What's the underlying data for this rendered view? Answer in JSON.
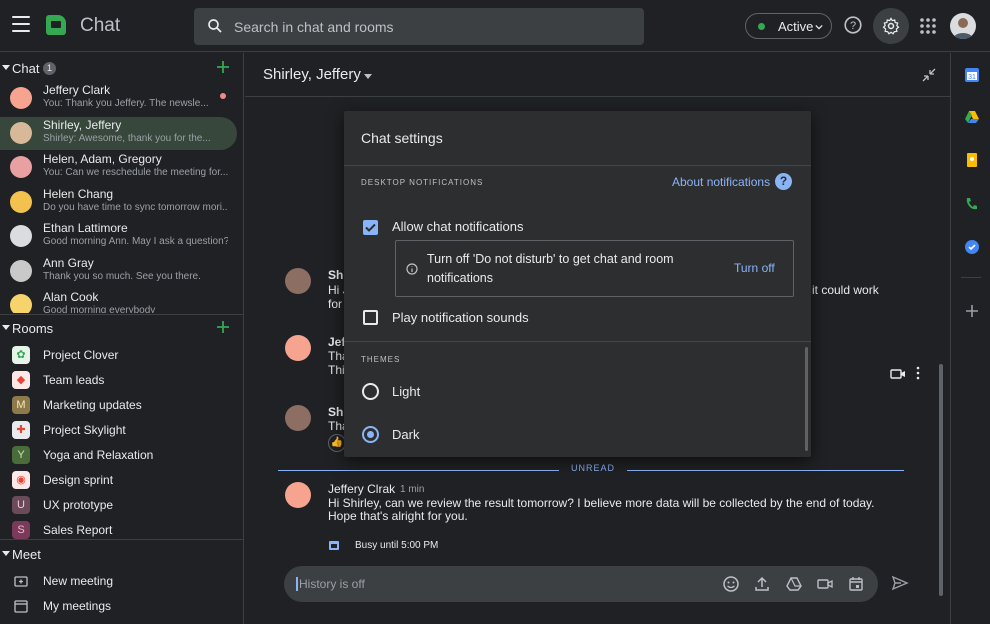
{
  "topbar": {
    "app_title": "Chat",
    "search_placeholder": "Search in chat and rooms",
    "status_label": "Active"
  },
  "sidebar": {
    "chat_section": {
      "label": "Chat",
      "badge": "1"
    },
    "chats": [
      {
        "name": "Jeffery Clark",
        "snippet": "You: Thank you Jeffery. The newsle...",
        "unread": true,
        "color": "#f6a38f"
      },
      {
        "name": "Shirley, Jeffery",
        "snippet": "Shirley: Awesome, thank you for the...",
        "selected": true,
        "color": "#d7b899"
      },
      {
        "name": "Helen, Adam, Gregory",
        "snippet": "You: Can we reschedule the meeting for...",
        "color": "#e8a0a0"
      },
      {
        "name": "Helen Chang",
        "snippet": "Do you have time to sync tomorrow mori...",
        "color": "#f2c14e"
      },
      {
        "name": "Ethan Lattimore",
        "snippet": "Good morning Ann. May I ask a question?",
        "color": "#dadce0"
      },
      {
        "name": "Ann Gray",
        "snippet": "Thank you so much. See you there.",
        "color": "#c9c9c9"
      },
      {
        "name": "Alan Cook",
        "snippet": "Good morning everybody",
        "color": "#f6d36b"
      }
    ],
    "rooms_section": {
      "label": "Rooms"
    },
    "rooms": [
      {
        "name": "Project Clover",
        "glyph": "✿",
        "bg": "#e6f4ea",
        "fg": "#34a853"
      },
      {
        "name": "Team leads",
        "glyph": "◆",
        "bg": "#fce8e6",
        "fg": "#ea4335"
      },
      {
        "name": "Marketing updates",
        "glyph": "M",
        "bg": "#8d7a4a",
        "fg": "#f6e6b4"
      },
      {
        "name": "Project Skylight",
        "glyph": "✚",
        "bg": "#e8eaed",
        "fg": "#ea4335"
      },
      {
        "name": "Yoga and Relaxation",
        "glyph": "Y",
        "bg": "#4a6b3a",
        "fg": "#c8e6b4"
      },
      {
        "name": "Design sprint",
        "glyph": "◉",
        "bg": "#fce8e6",
        "fg": "#ea4335"
      },
      {
        "name": "UX prototype",
        "glyph": "U",
        "bg": "#6b4a5a",
        "fg": "#f2c8dc"
      },
      {
        "name": "Sales Report",
        "glyph": "S",
        "bg": "#7a3a5a",
        "fg": "#f2b8d2"
      }
    ],
    "meet_section": {
      "label": "Meet"
    },
    "meet": [
      {
        "name": "New meeting"
      },
      {
        "name": "My meetings"
      }
    ]
  },
  "conversation": {
    "title": "Shirley, Jeffery",
    "messages": [
      {
        "name": "Shi",
        "lines": [
          "Hi J",
          "for"
        ],
        "tail": "it could work"
      },
      {
        "name": "Jef",
        "lines": [
          "Tha",
          "Thi"
        ]
      },
      {
        "name": "Shi",
        "lines": [
          "Tha"
        ]
      }
    ],
    "unread_label": "UNREAD",
    "last_message": {
      "name": "Jeffery Clrak",
      "time": "1 min",
      "lines": [
        "Hi Shirley, can we review the result tomorrow? I believe more data will be collected by the end of today.",
        "Hope that's alright for you."
      ],
      "busy": "Busy until 5:00 PM"
    },
    "composer_placeholder": "History is off"
  },
  "settings": {
    "title": "Chat settings",
    "desktop_section": "DESKTOP NOTIFICATIONS",
    "about_link": "About notifications",
    "allow_label": "Allow chat notifications",
    "allow_checked": true,
    "notice_text": "Turn off 'Do not disturb' to get chat and room notifications",
    "notice_action": "Turn off",
    "sounds_label": "Play notification sounds",
    "sounds_checked": false,
    "themes_section": "THEMES",
    "theme_light": "Light",
    "theme_dark": "Dark",
    "selected_theme": "Dark"
  },
  "colors": {
    "accent": "#8ab4f8",
    "active": "#34a853",
    "selected_chat": "#37473b"
  }
}
